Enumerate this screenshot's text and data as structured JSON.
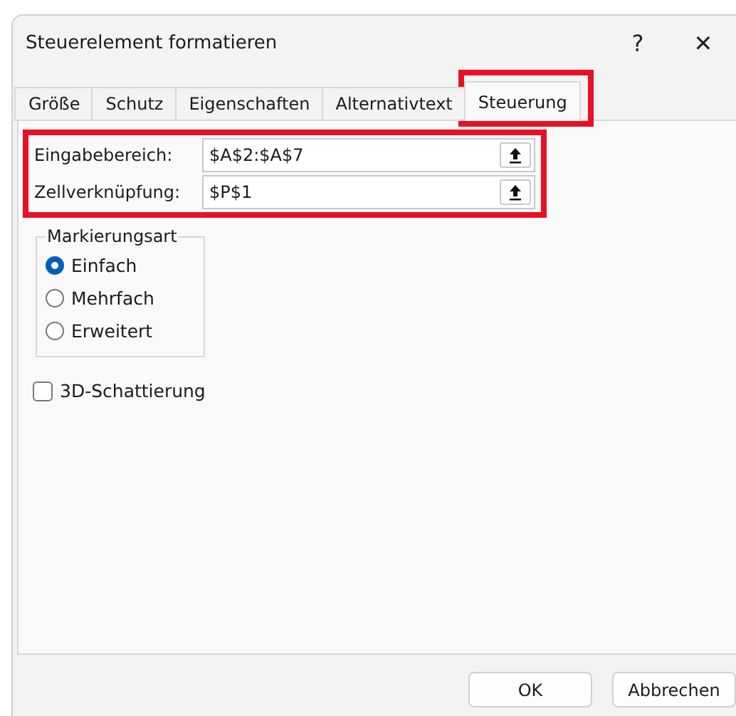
{
  "window": {
    "title": "Steuerelement formatieren",
    "help": "?",
    "close": "✕"
  },
  "tabs": [
    {
      "label": "Größe",
      "selected": false,
      "highlighted": false
    },
    {
      "label": "Schutz",
      "selected": false,
      "highlighted": false
    },
    {
      "label": "Eigenschaften",
      "selected": false,
      "highlighted": false
    },
    {
      "label": "Alternativtext",
      "selected": false,
      "highlighted": false
    },
    {
      "label": "Steuerung",
      "selected": true,
      "highlighted": true
    }
  ],
  "fields_highlighted": true,
  "fields": [
    {
      "label": "Eingabebereich:",
      "value": "$A$2:$A$7"
    },
    {
      "label": "Zellverknüpfung:",
      "value": "$P$1"
    }
  ],
  "selection_group": {
    "title": "Markierungsart",
    "options": [
      {
        "label": "Einfach",
        "selected": true
      },
      {
        "label": "Mehrfach",
        "selected": false
      },
      {
        "label": "Erweitert",
        "selected": false
      }
    ]
  },
  "shading": {
    "label": "3D-Schattierung",
    "checked": false
  },
  "buttons": [
    "OK",
    "Abbrechen"
  ]
}
